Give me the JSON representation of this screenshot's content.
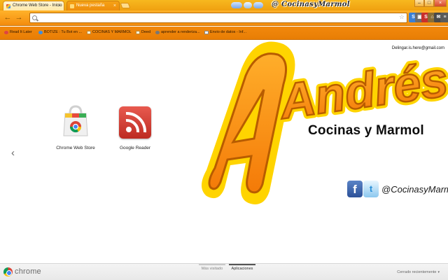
{
  "window": {
    "tabs": [
      {
        "title": "Chrome Web Store - Inicio",
        "close": "×"
      },
      {
        "title": "Nueva pestaña",
        "close": "×"
      }
    ],
    "header_handle": "@ CocinasyMarmol",
    "controls": {
      "minimize": "–",
      "maximize": "□",
      "close": "×"
    }
  },
  "toolbar": {
    "back": "←",
    "forward": "→",
    "address_value": "",
    "star": "☆",
    "extensions": [
      {
        "name": "extension-1",
        "glyph": "S",
        "color": "#3a7fd5"
      },
      {
        "name": "extension-2",
        "glyph": "▣",
        "color": "#6c6c6c"
      },
      {
        "name": "extension-3",
        "glyph": "S",
        "color": "#c9302c"
      },
      {
        "name": "extension-4",
        "glyph": "⌂",
        "color": "#8a6e35"
      },
      {
        "name": "extension-5",
        "glyph": "✉",
        "color": "#4a4a4a"
      },
      {
        "name": "extension-6",
        "glyph": "≡",
        "color": "#5b5b5b"
      }
    ]
  },
  "bookmarks": [
    {
      "label": "Read It Later",
      "icon": "circle"
    },
    {
      "label": "BOTIZE : Tu Bot en ...",
      "icon": "rsc"
    },
    {
      "label": "COCINAS Y MARMOL",
      "icon": "folder"
    },
    {
      "label": "Deed",
      "icon": "folder"
    },
    {
      "label": "aprender a renderiza...",
      "icon": "gear"
    },
    {
      "label": "Envio de datos - Inf...",
      "icon": "doc"
    }
  ],
  "page": {
    "user_email": "Delingar.is.here@gmail.com",
    "brand_name": "Andrés",
    "brand_subtitle": "Cocinas y Marmol",
    "social_handle": "@CocinasyMarmol",
    "prev_arrow": "‹",
    "apps": [
      {
        "label": "Chrome Web Store"
      },
      {
        "label": "Google Reader"
      }
    ],
    "colors": {
      "brand_orange": "#f7941d",
      "brand_yellow": "#ffd400",
      "brand_outline": "#b85c00"
    }
  },
  "bottom": {
    "chrome_word": "chrome",
    "tabs": [
      {
        "label": "Más visitado",
        "active": false
      },
      {
        "label": "Aplicaciones",
        "active": true
      }
    ],
    "recently_closed": "Cerrado recientemente",
    "caret": "▾"
  }
}
